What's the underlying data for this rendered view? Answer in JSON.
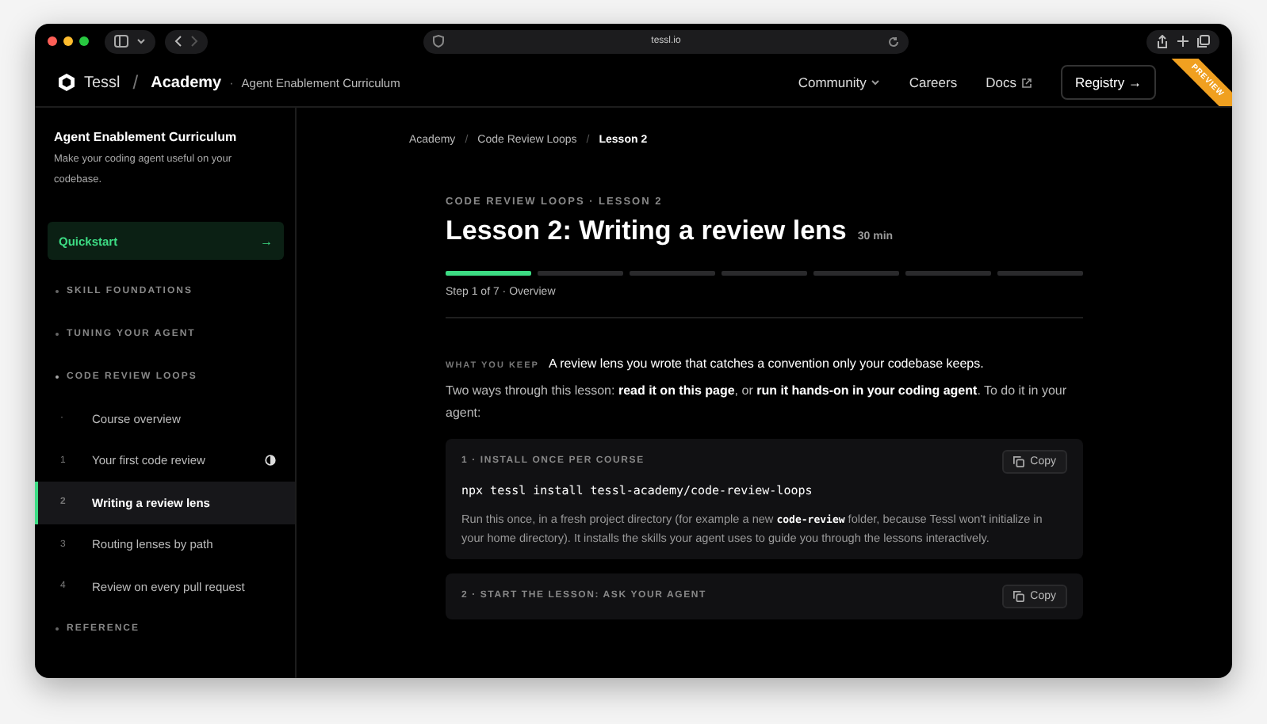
{
  "browser": {
    "url": "tessl.io"
  },
  "header": {
    "brand": "Tessl",
    "slash": "/",
    "section": "Academy",
    "dot": "·",
    "subtitle": "Agent Enablement Curriculum",
    "nav": [
      {
        "label": "Community",
        "kind": "dropdown"
      },
      {
        "label": "Careers",
        "kind": "link"
      },
      {
        "label": "Docs",
        "kind": "external"
      }
    ],
    "cta": "Registry →",
    "ribbon": "PREVIEW"
  },
  "sidebar": {
    "title": "Agent Enablement Curriculum",
    "description": "Make your coding agent useful on your codebase.",
    "quickstart": {
      "label": "Quickstart",
      "arrow": "→"
    },
    "items": [
      {
        "kind": "section",
        "label": "SKILL FOUNDATIONS",
        "expanded": false
      },
      {
        "kind": "section",
        "label": "TUNING YOUR AGENT",
        "expanded": false
      },
      {
        "kind": "section",
        "label": "CODE REVIEW LOOPS",
        "expanded": true,
        "children": [
          {
            "number": "·",
            "label": "Course overview",
            "selected": false,
            "in_progress": false
          },
          {
            "number": "1",
            "label": "Your first code review",
            "selected": false,
            "in_progress": true
          },
          {
            "number": "2",
            "label": "Writing a review lens",
            "selected": true,
            "in_progress": false
          },
          {
            "number": "3",
            "label": "Routing lenses by path",
            "selected": false,
            "in_progress": false
          },
          {
            "number": "4",
            "label": "Review on every pull request",
            "selected": false,
            "in_progress": false
          }
        ]
      },
      {
        "kind": "section",
        "label": "REFERENCE",
        "expanded": false
      }
    ]
  },
  "breadcrumb_separator": "/",
  "breadcrumb": [
    {
      "label": "Academy",
      "current": false
    },
    {
      "label": "Code Review Loops",
      "current": false
    },
    {
      "label": "Lesson 2",
      "current": true
    }
  ],
  "lesson": {
    "eyebrow": "CODE REVIEW LOOPS · LESSON 2",
    "title": "Lesson 2: Writing a review lens",
    "duration": "30 min",
    "progress": [
      {
        "done": true
      },
      {
        "done": false
      },
      {
        "done": false
      },
      {
        "done": false
      },
      {
        "done": false
      },
      {
        "done": false
      },
      {
        "done": false
      }
    ],
    "step": "Step 1 of 7 · Overview",
    "keep_label": "WHAT YOU KEEP",
    "keep_text": "A review lens you wrote that catches a convention only your codebase keeps.",
    "intro": "Two ways through this lesson: **read it on this page**, or **run it hands-on in your coding agent**. To do it in your agent:",
    "blocks": [
      {
        "heading": "1 · INSTALL ONCE PER COURSE",
        "copy": "Copy",
        "command": "npx tessl install tessl-academy/code-review-loops",
        "note": [
          {
            "kind": "text",
            "text": "Run this once, in a fresh project directory (for example a new "
          },
          {
            "kind": "code",
            "text": "code-review"
          },
          {
            "kind": "text",
            "text": " folder, because Tessl won't initialize in your home directory). It installs the skills your agent uses to guide you through the lessons interactively."
          }
        ]
      },
      {
        "heading": "2 · START THE LESSON: ASK YOUR AGENT",
        "copy": "Copy"
      }
    ]
  }
}
